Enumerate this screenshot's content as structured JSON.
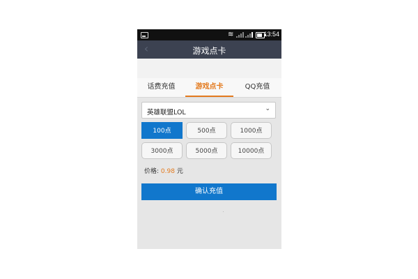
{
  "status_bar": {
    "time": "13:54",
    "battery_level": 0.75
  },
  "header": {
    "back_icon": "chevron-left-icon",
    "title": "游戏点卡"
  },
  "tabs": [
    {
      "label": "话费充值",
      "active": false
    },
    {
      "label": "游戏点卡",
      "active": true
    },
    {
      "label": "QQ充值",
      "active": false
    }
  ],
  "game_select": {
    "value": "英雄联盟LOL",
    "icon": "chevron-down-icon"
  },
  "amount_options": [
    {
      "label": "100点",
      "selected": true
    },
    {
      "label": "500点",
      "selected": false
    },
    {
      "label": "1000点",
      "selected": false
    },
    {
      "label": "3000点",
      "selected": false
    },
    {
      "label": "5000点",
      "selected": false
    },
    {
      "label": "10000点",
      "selected": false
    }
  ],
  "price": {
    "label": "价格:",
    "value": "0.98",
    "unit": "元"
  },
  "confirm_button": {
    "label": "确认充值"
  },
  "colors": {
    "accent_blue": "#1177cc",
    "accent_orange": "#e37a1e",
    "title_bar": "#3c4251"
  }
}
